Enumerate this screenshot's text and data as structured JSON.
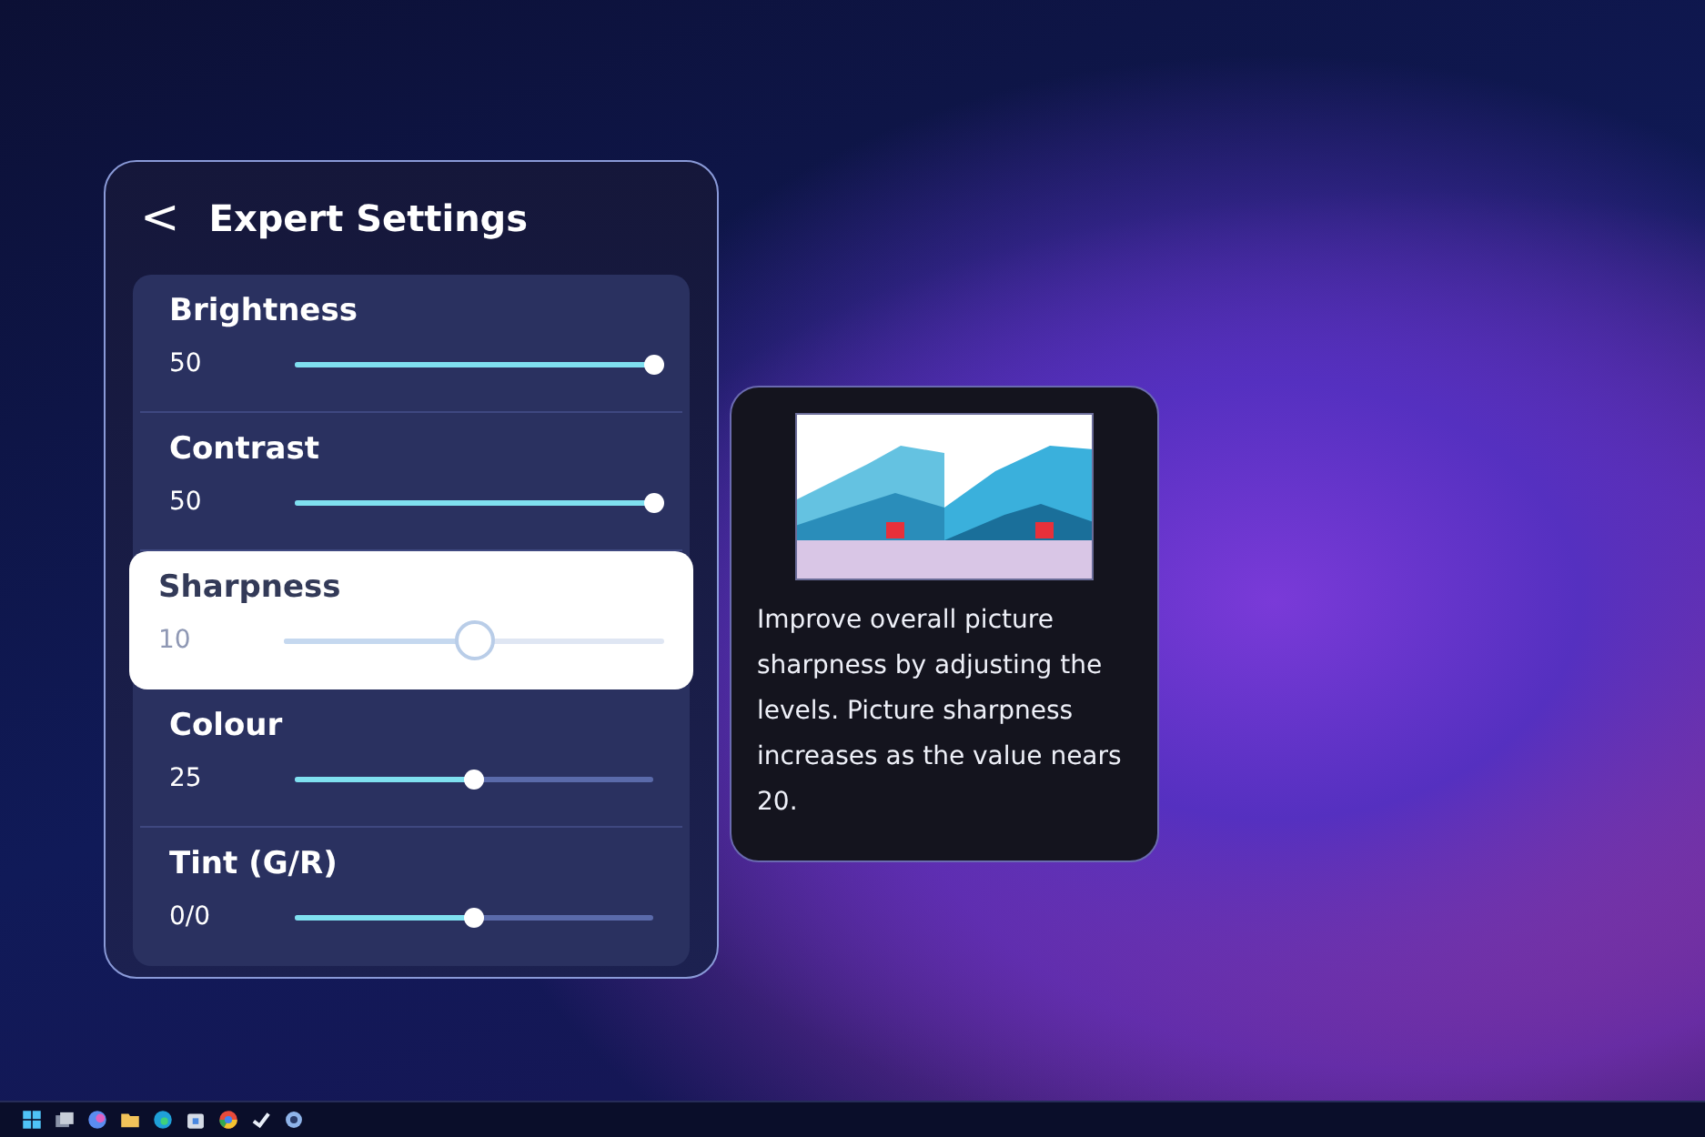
{
  "panel": {
    "title": "Expert Settings",
    "back_icon": "<",
    "settings": [
      {
        "label": "Brightness",
        "value": "50",
        "level": 1.0,
        "selected": false
      },
      {
        "label": "Contrast",
        "value": "50",
        "level": 1.0,
        "selected": false
      },
      {
        "label": "Sharpness",
        "value": "10",
        "level": 0.5,
        "selected": true
      },
      {
        "label": "Colour",
        "value": "25",
        "level": 0.5,
        "selected": false
      },
      {
        "label": "Tint (G/R)",
        "value": "0/0",
        "level": 0.5,
        "selected": false
      }
    ]
  },
  "help_card": {
    "text": "Improve overall picture sharpness by adjusting the levels. Picture sharpness increases as the value nears 20."
  },
  "taskbar": {
    "icons": [
      {
        "kind": "start"
      },
      {
        "kind": "taskview"
      },
      {
        "kind": "app"
      },
      {
        "kind": "folder"
      },
      {
        "kind": "edge"
      },
      {
        "kind": "store"
      },
      {
        "kind": "chrome"
      },
      {
        "kind": "steam"
      },
      {
        "kind": "settings"
      }
    ]
  }
}
